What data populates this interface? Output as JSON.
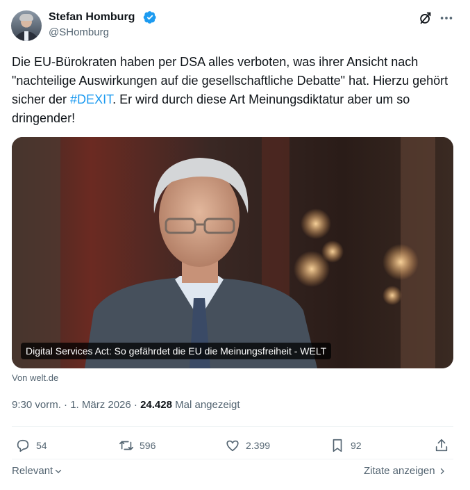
{
  "author": {
    "name": "Stefan Homburg",
    "handle": "@SHomburg"
  },
  "tweet": {
    "text_before": "Die EU-Bürokraten haben per DSA alles verboten, was ihrer Ansicht nach \"nachteilige Auswirkungen auf die gesellschaftliche Debatte\" hat. Hierzu gehört sicher der ",
    "hashtag": "#DEXIT",
    "text_after": ". Er wird durch diese Art Meinungsdiktatur aber um so dringender!"
  },
  "card": {
    "caption": "Digital Services Act: So gefährdet die EU die Meinungsfreiheit - WELT",
    "source": "Von welt.de"
  },
  "meta": {
    "time_date": "9:30 vorm. · 1. März 2026 · ",
    "views_count": "24.428",
    "views_label": " Mal angezeigt"
  },
  "actions": {
    "replies": "54",
    "reposts": "596",
    "likes": "2.399",
    "bookmarks": "92"
  },
  "footer": {
    "sort_label": "Relevant",
    "quotes_label": "Zitate anzeigen"
  },
  "colors": {
    "accent": "#1d9bf0",
    "text": "#0f1419",
    "secondary": "#536471"
  },
  "icons": [
    "verified-badge-icon",
    "grok-icon",
    "more-icon",
    "reply-icon",
    "repost-icon",
    "like-icon",
    "bookmark-icon",
    "share-icon",
    "chevron-down-icon",
    "chevron-right-icon"
  ]
}
